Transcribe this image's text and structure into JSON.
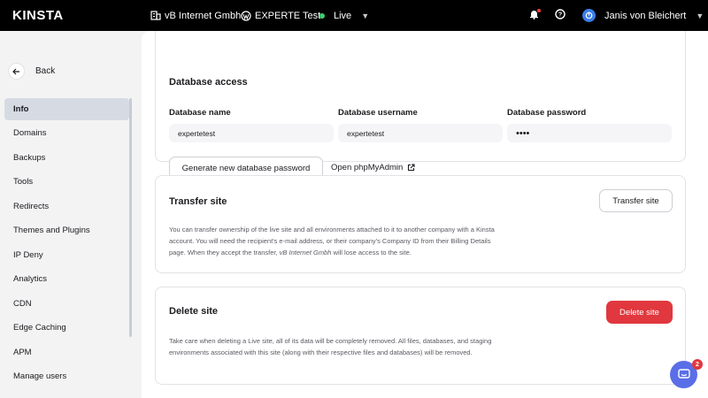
{
  "app": {
    "logo": "KINSTA"
  },
  "topbar": {
    "company": "vB Internet Gmbh",
    "site": "EXPERTE Test",
    "environment": "Live",
    "user": "Janis von Bleichert"
  },
  "sidebar": {
    "back_label": "Back",
    "items": [
      {
        "label": "Info",
        "active": true
      },
      {
        "label": "Domains"
      },
      {
        "label": "Backups"
      },
      {
        "label": "Tools"
      },
      {
        "label": "Redirects"
      },
      {
        "label": "Themes and Plugins"
      },
      {
        "label": "IP Deny"
      },
      {
        "label": "Analytics"
      },
      {
        "label": "CDN"
      },
      {
        "label": "Edge Caching"
      },
      {
        "label": "APM"
      },
      {
        "label": "Manage users"
      }
    ]
  },
  "database_access": {
    "title": "Database access",
    "name_label": "Database name",
    "name_value": "expertetest",
    "username_label": "Database username",
    "username_value": "expertetest",
    "password_label": "Database password",
    "password_value": "••••",
    "generate_button": "Generate new database password",
    "phpmyadmin_link": "Open phpMyAdmin"
  },
  "transfer_site": {
    "title": "Transfer site",
    "button": "Transfer site",
    "desc_part1": "You can transfer ownership of the live site and all environments attached to it to another company with a Kinsta account. You will need the recipient's e-mail address, or their company's Company ID from their Billing Details page. When they accept the transfer, ",
    "desc_company": "vB Internet Gmbh",
    "desc_part2": " will lose access to the site."
  },
  "delete_site": {
    "title": "Delete site",
    "button": "Delete site",
    "desc": "Take care when deleting a Live site, all of its data will be completely removed. All files, databases, and staging environments associated with this site (along with their respective files and databases) will be removed."
  },
  "chat": {
    "badge_count": "2"
  },
  "colors": {
    "accent": "#5a6ee8",
    "danger": "#e0383e",
    "live": "#3bd16f"
  }
}
